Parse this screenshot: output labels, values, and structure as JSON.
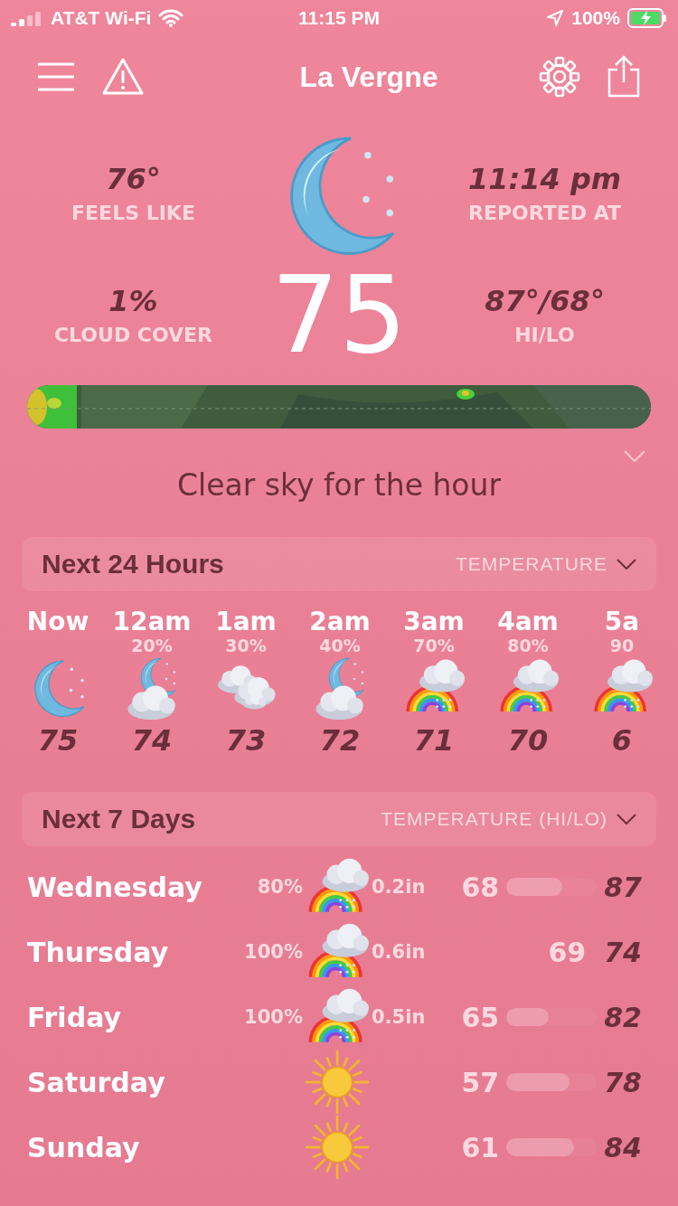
{
  "status_bar": {
    "carrier": "AT&T Wi-Fi",
    "time": "11:15 PM",
    "battery": "100%"
  },
  "header": {
    "title": "La Vergne"
  },
  "current": {
    "kind": "moon",
    "temperature": "75",
    "stats": [
      {
        "value": "76°",
        "label": "FEELS LIKE"
      },
      {
        "value": "11:14 pm",
        "label": "REPORTED AT"
      },
      {
        "value": "1%",
        "label": "CLOUD COVER"
      },
      {
        "value": "87°/68°",
        "label": "HI/LO"
      }
    ]
  },
  "summary": "Clear sky for the hour",
  "hourly": {
    "title": "Next 24 Hours",
    "selector": "TEMPERATURE",
    "items": [
      {
        "time": "Now",
        "kind": "moon",
        "temp": "75"
      },
      {
        "time": "12am",
        "precip": "20%",
        "kind": "moon-cloud",
        "temp": "74"
      },
      {
        "time": "1am",
        "precip": "30%",
        "kind": "cloud",
        "temp": "73"
      },
      {
        "time": "2am",
        "precip": "40%",
        "kind": "moon-cloud",
        "temp": "72"
      },
      {
        "time": "3am",
        "precip": "70%",
        "kind": "rain-rainbow",
        "temp": "71"
      },
      {
        "time": "4am",
        "precip": "80%",
        "kind": "rain-rainbow",
        "temp": "70"
      },
      {
        "time": "5a",
        "precip": "90",
        "kind": "rain-rainbow",
        "temp": "6"
      }
    ]
  },
  "daily": {
    "title": "Next 7 Days",
    "selector": "TEMPERATURE (HI/LO)",
    "days": [
      {
        "day": "Wednesday",
        "precip": "80%",
        "kind": "rain-rainbow",
        "amount": "0.2in",
        "lo": "68",
        "hi": "87",
        "level": 0.62
      },
      {
        "day": "Thursday",
        "precip": "100%",
        "kind": "rain-rainbow",
        "amount": "0.6in",
        "lo": "69",
        "hi": "74"
      },
      {
        "day": "Friday",
        "precip": "100%",
        "kind": "rain-rainbow",
        "amount": "0.5in",
        "lo": "65",
        "hi": "82",
        "level": 0.47
      },
      {
        "day": "Saturday",
        "kind": "sun",
        "lo": "57",
        "hi": "78",
        "level": 0.7
      },
      {
        "day": "Sunday",
        "kind": "sun",
        "lo": "61",
        "hi": "84",
        "level": 0.75
      }
    ]
  }
}
